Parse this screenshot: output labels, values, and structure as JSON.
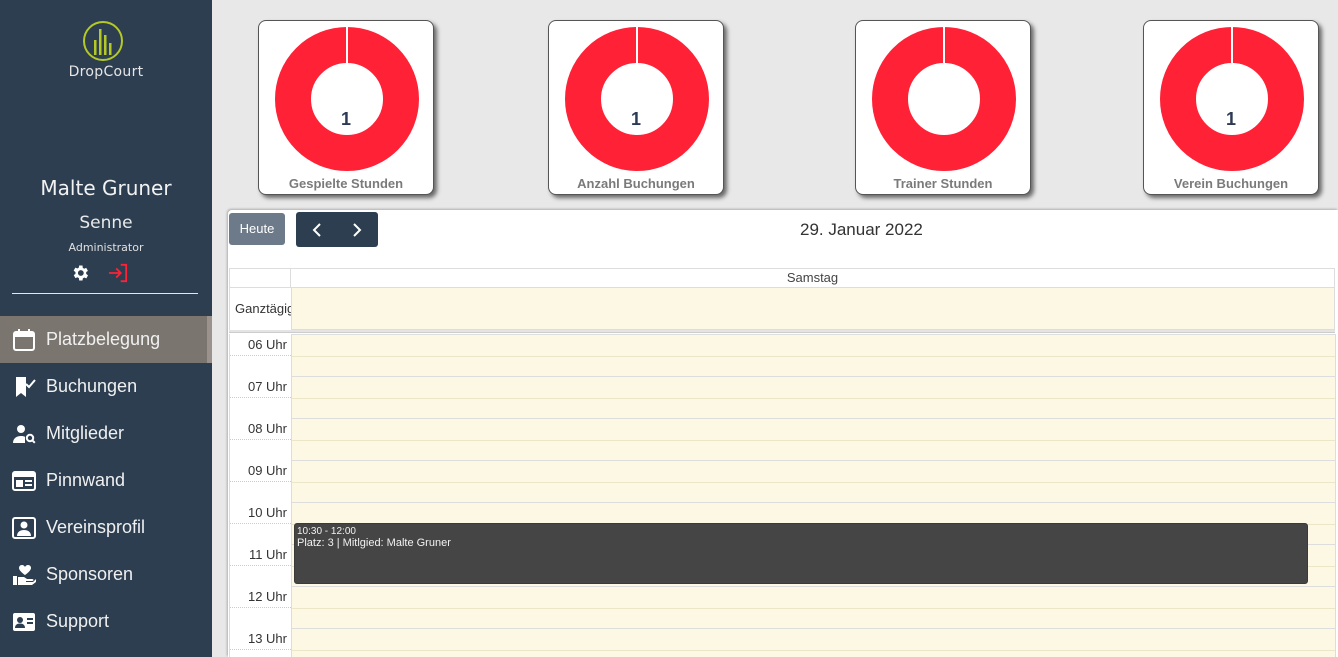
{
  "app": {
    "brand": "DropCourt"
  },
  "user": {
    "name": "Malte Gruner",
    "club": "Senne",
    "role": "Administrator"
  },
  "nav": {
    "items": [
      {
        "label": "Platzbelegung",
        "icon": "calendar-icon",
        "active": true
      },
      {
        "label": "Buchungen",
        "icon": "bookmark-check-icon"
      },
      {
        "label": "Mitglieder",
        "icon": "user-search-icon"
      },
      {
        "label": "Pinnwand",
        "icon": "board-icon"
      },
      {
        "label": "Vereinsprofil",
        "icon": "profile-card-icon"
      },
      {
        "label": "Sponsoren",
        "icon": "hand-heart-icon"
      },
      {
        "label": "Support",
        "icon": "contact-card-icon"
      }
    ]
  },
  "stats": [
    {
      "label": "Gespielte Stunden",
      "value": "1"
    },
    {
      "label": "Anzahl Buchungen",
      "value": "1"
    },
    {
      "label": "Trainer Stunden",
      "value": ""
    },
    {
      "label": "Verein Buchungen",
      "value": "1"
    }
  ],
  "colors": {
    "sidebar": "#2c3e50",
    "donut": "#ff2136",
    "active_nav": "#7b7570",
    "calendar_bg": "#fcf8e3",
    "event": "#454545",
    "logo": "#b5c926"
  },
  "calendar": {
    "today_label": "Heute",
    "title": "29. Januar 2022",
    "day_header": "Samstag",
    "allday_label": "Ganztägig",
    "time_slots": [
      "06 Uhr",
      "07 Uhr",
      "08 Uhr",
      "09 Uhr",
      "10 Uhr",
      "11 Uhr",
      "12 Uhr",
      "13 Uhr"
    ],
    "event": {
      "time": "10:30 - 12:00",
      "title": "Platz: 3 | Mitlgied: Malte Gruner"
    }
  }
}
